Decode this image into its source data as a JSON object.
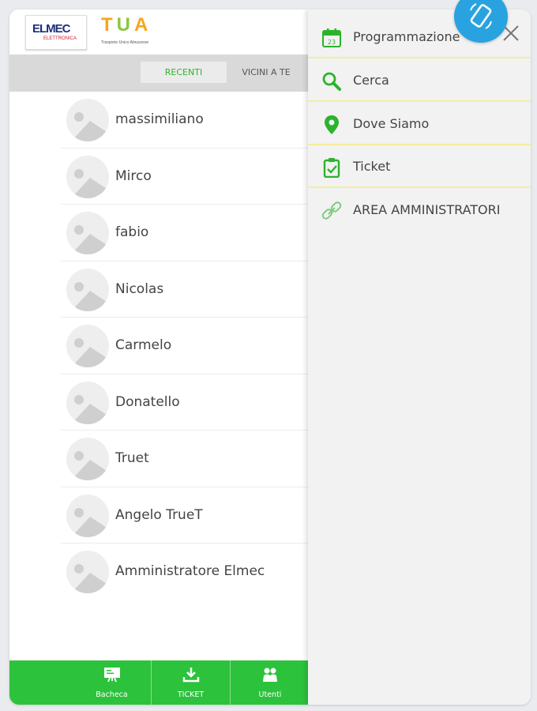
{
  "header": {
    "logo_elmec": {
      "brand_main": "ELMEC",
      "brand_sub": "ELETTRONICA"
    },
    "logo_tua": {
      "letters": [
        "T",
        "U",
        "A"
      ],
      "tagline": "Trasporto Unico Abruzzese"
    }
  },
  "tabs": [
    {
      "label": "RECENTI",
      "active": true
    },
    {
      "label": "VICINI A TE",
      "active": false
    }
  ],
  "users": [
    {
      "name": "massimiliano"
    },
    {
      "name": "Mirco"
    },
    {
      "name": "fabio"
    },
    {
      "name": "Nicolas"
    },
    {
      "name": "Carmelo"
    },
    {
      "name": "Donatello"
    },
    {
      "name": "Truet"
    },
    {
      "name": "Angelo TrueT"
    },
    {
      "name": "Amministratore Elmec"
    }
  ],
  "bottom_nav": [
    {
      "label": "Bacheca",
      "icon": "board-icon"
    },
    {
      "label": "TICKET",
      "icon": "download-icon"
    },
    {
      "label": "Utenti",
      "icon": "users-icon"
    }
  ],
  "drawer": {
    "items": [
      {
        "label": "Programmazione",
        "icon": "calendar-icon",
        "calendar_day": "23"
      },
      {
        "label": "Cerca",
        "icon": "search-icon"
      },
      {
        "label": "Dove Siamo",
        "icon": "location-pin-icon"
      },
      {
        "label": "Ticket",
        "icon": "clipboard-icon"
      },
      {
        "label": "AREA AMMINISTRATORI",
        "icon": "link-icon"
      }
    ]
  },
  "colors": {
    "accent_green": "#2cc23c",
    "tab_active_text": "#2db42d",
    "drawer_separator": "#f4ed9e",
    "fab_blue": "#29a3e0"
  }
}
